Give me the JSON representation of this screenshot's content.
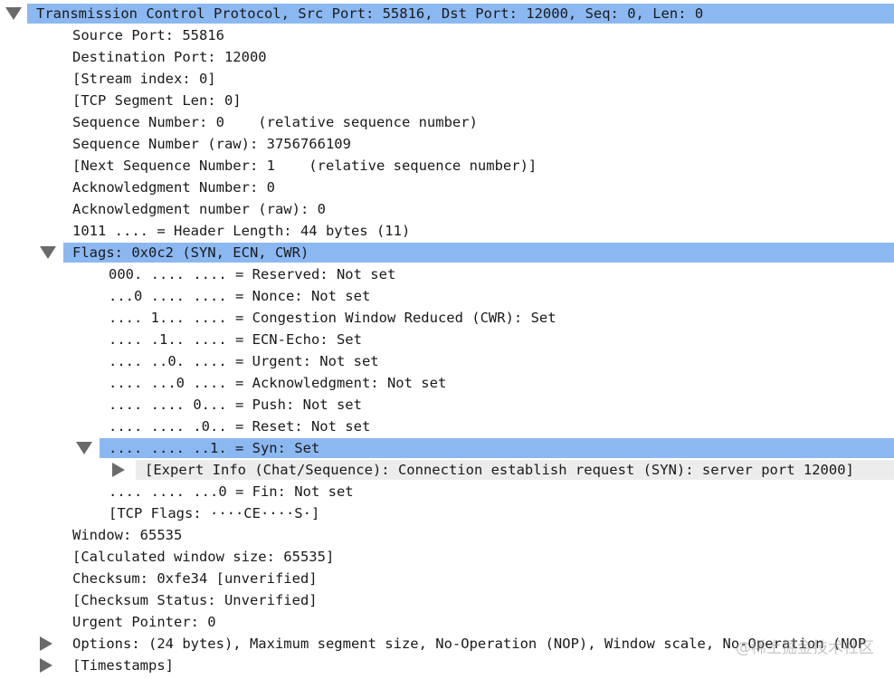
{
  "rows": [
    {
      "level": 0,
      "toggle": "down",
      "selected": true,
      "text": "Transmission Control Protocol, Src Port: 55816, Dst Port: 12000, Seq: 0, Len: 0"
    },
    {
      "level": 1,
      "toggle": null,
      "text": "Source Port: 55816"
    },
    {
      "level": 1,
      "toggle": null,
      "text": "Destination Port: 12000"
    },
    {
      "level": 1,
      "toggle": null,
      "text": "[Stream index: 0]"
    },
    {
      "level": 1,
      "toggle": null,
      "text": "[TCP Segment Len: 0]"
    },
    {
      "level": 1,
      "toggle": null,
      "text": "Sequence Number: 0    (relative sequence number)"
    },
    {
      "level": 1,
      "toggle": null,
      "text": "Sequence Number (raw): 3756766109"
    },
    {
      "level": 1,
      "toggle": null,
      "text": "[Next Sequence Number: 1    (relative sequence number)]"
    },
    {
      "level": 1,
      "toggle": null,
      "text": "Acknowledgment Number: 0"
    },
    {
      "level": 1,
      "toggle": null,
      "text": "Acknowledgment number (raw): 0"
    },
    {
      "level": 1,
      "toggle": null,
      "text": "1011 .... = Header Length: 44 bytes (11)"
    },
    {
      "level": 1,
      "toggle": "down",
      "selected": true,
      "text": "Flags: 0x0c2 (SYN, ECN, CWR)"
    },
    {
      "level": 2,
      "toggle": null,
      "text": "000. .... .... = Reserved: Not set"
    },
    {
      "level": 2,
      "toggle": null,
      "text": "...0 .... .... = Nonce: Not set"
    },
    {
      "level": 2,
      "toggle": null,
      "text": ".... 1... .... = Congestion Window Reduced (CWR): Set"
    },
    {
      "level": 2,
      "toggle": null,
      "text": ".... .1.. .... = ECN-Echo: Set"
    },
    {
      "level": 2,
      "toggle": null,
      "text": ".... ..0. .... = Urgent: Not set"
    },
    {
      "level": 2,
      "toggle": null,
      "text": ".... ...0 .... = Acknowledgment: Not set"
    },
    {
      "level": 2,
      "toggle": null,
      "text": ".... .... 0... = Push: Not set"
    },
    {
      "level": 2,
      "toggle": null,
      "text": ".... .... .0.. = Reset: Not set"
    },
    {
      "level": 2,
      "toggle": "down",
      "selected": true,
      "text": ".... .... ..1. = Syn: Set"
    },
    {
      "level": 3,
      "toggle": "right",
      "gray": true,
      "text": "[Expert Info (Chat/Sequence): Connection establish request (SYN): server port 12000]"
    },
    {
      "level": 2,
      "toggle": null,
      "text": ".... .... ...0 = Fin: Not set"
    },
    {
      "level": 2,
      "toggle": null,
      "text": "[TCP Flags: ····CE····S·]"
    },
    {
      "level": 1,
      "toggle": null,
      "text": "Window: 65535"
    },
    {
      "level": 1,
      "toggle": null,
      "text": "[Calculated window size: 65535]"
    },
    {
      "level": 1,
      "toggle": null,
      "text": "Checksum: 0xfe34 [unverified]"
    },
    {
      "level": 1,
      "toggle": null,
      "text": "[Checksum Status: Unverified]"
    },
    {
      "level": 1,
      "toggle": null,
      "text": "Urgent Pointer: 0"
    },
    {
      "level": 1,
      "toggle": "right",
      "text": "Options: (24 bytes), Maximum segment size, No-Operation (NOP), Window scale, No-Operation (NOP"
    },
    {
      "level": 1,
      "toggle": "right",
      "text": "[Timestamps]"
    }
  ],
  "watermark": "@稀土掘金技术社区",
  "colors": {
    "selected_bg": "#8cb8f2",
    "expert_bg": "#ececec",
    "triangle": "#6a6a6a"
  }
}
